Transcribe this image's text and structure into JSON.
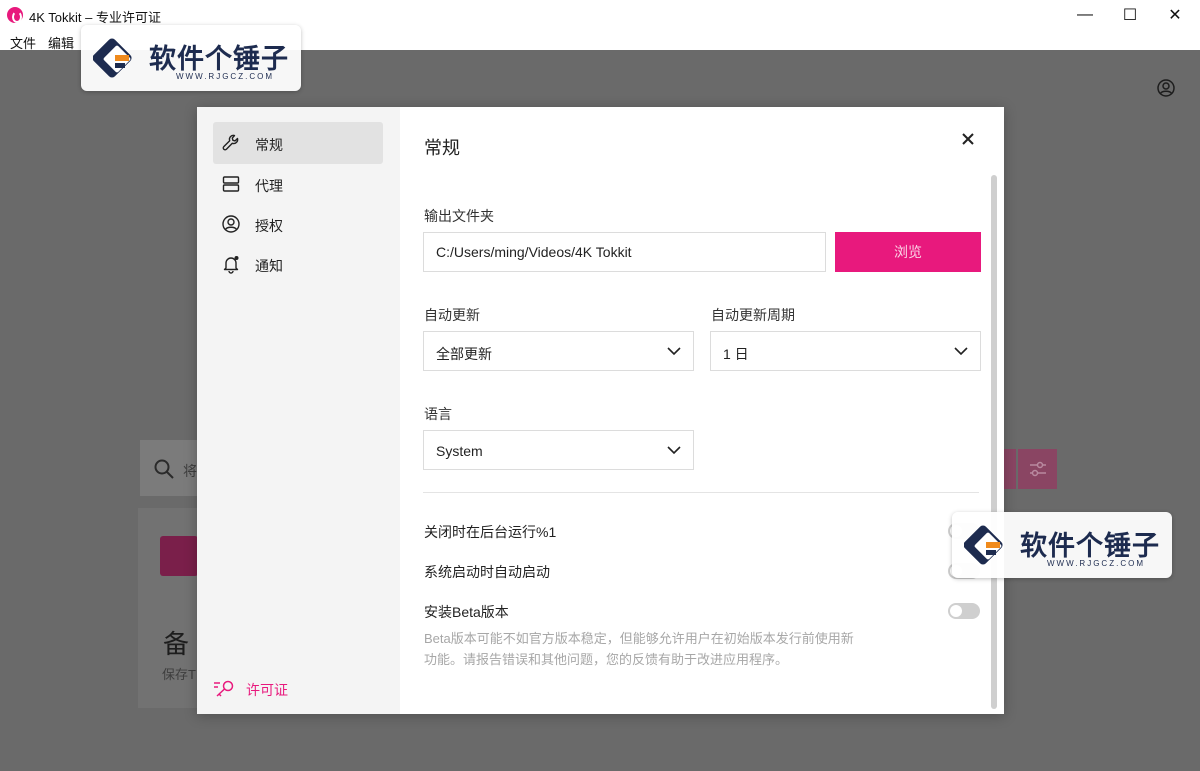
{
  "window": {
    "title": "4K Tokkit – 专业许可证",
    "controls": [
      "—",
      "☐",
      "✕"
    ]
  },
  "menu": {
    "file": "文件",
    "edit": "编辑"
  },
  "background": {
    "search_placeholder": "将",
    "card_title": "备",
    "card_subtitle": "保存T"
  },
  "dialog": {
    "sidebar": {
      "items": [
        {
          "label": "常规",
          "icon": "wrench-icon",
          "active": true
        },
        {
          "label": "代理",
          "icon": "server-icon",
          "active": false
        },
        {
          "label": "授权",
          "icon": "user-circle-icon",
          "active": false
        },
        {
          "label": "通知",
          "icon": "bell-icon",
          "active": false
        }
      ],
      "license_label": "许可证",
      "license_icon": "key-icon"
    },
    "title": "常规",
    "output_folder": {
      "label": "输出文件夹",
      "value": "C:/Users/ming/Videos/4K Tokkit",
      "browse_label": "浏览"
    },
    "auto_update": {
      "label": "自动更新",
      "value": "全部更新"
    },
    "auto_update_period": {
      "label": "自动更新周期",
      "value": "1 日"
    },
    "language": {
      "label": "语言",
      "value": "System"
    },
    "toggles": {
      "run_in_background": "关闭时在后台运行%1",
      "autostart": "系统启动时自动启动",
      "install_beta": "安装Beta版本"
    },
    "beta_description": "Beta版本可能不如官方版本稳定，但能够允许用户在初始版本发行前使用新功能。请报告错误和其他问题，您的反馈有助于改进应用程序。"
  },
  "watermark": {
    "title": "软件个锤子",
    "url": "WWW.RJGCZ.COM"
  },
  "colors": {
    "accent": "#e8197d",
    "overlay": "#6a6a6a",
    "sidebar": "#f4f4f4"
  }
}
